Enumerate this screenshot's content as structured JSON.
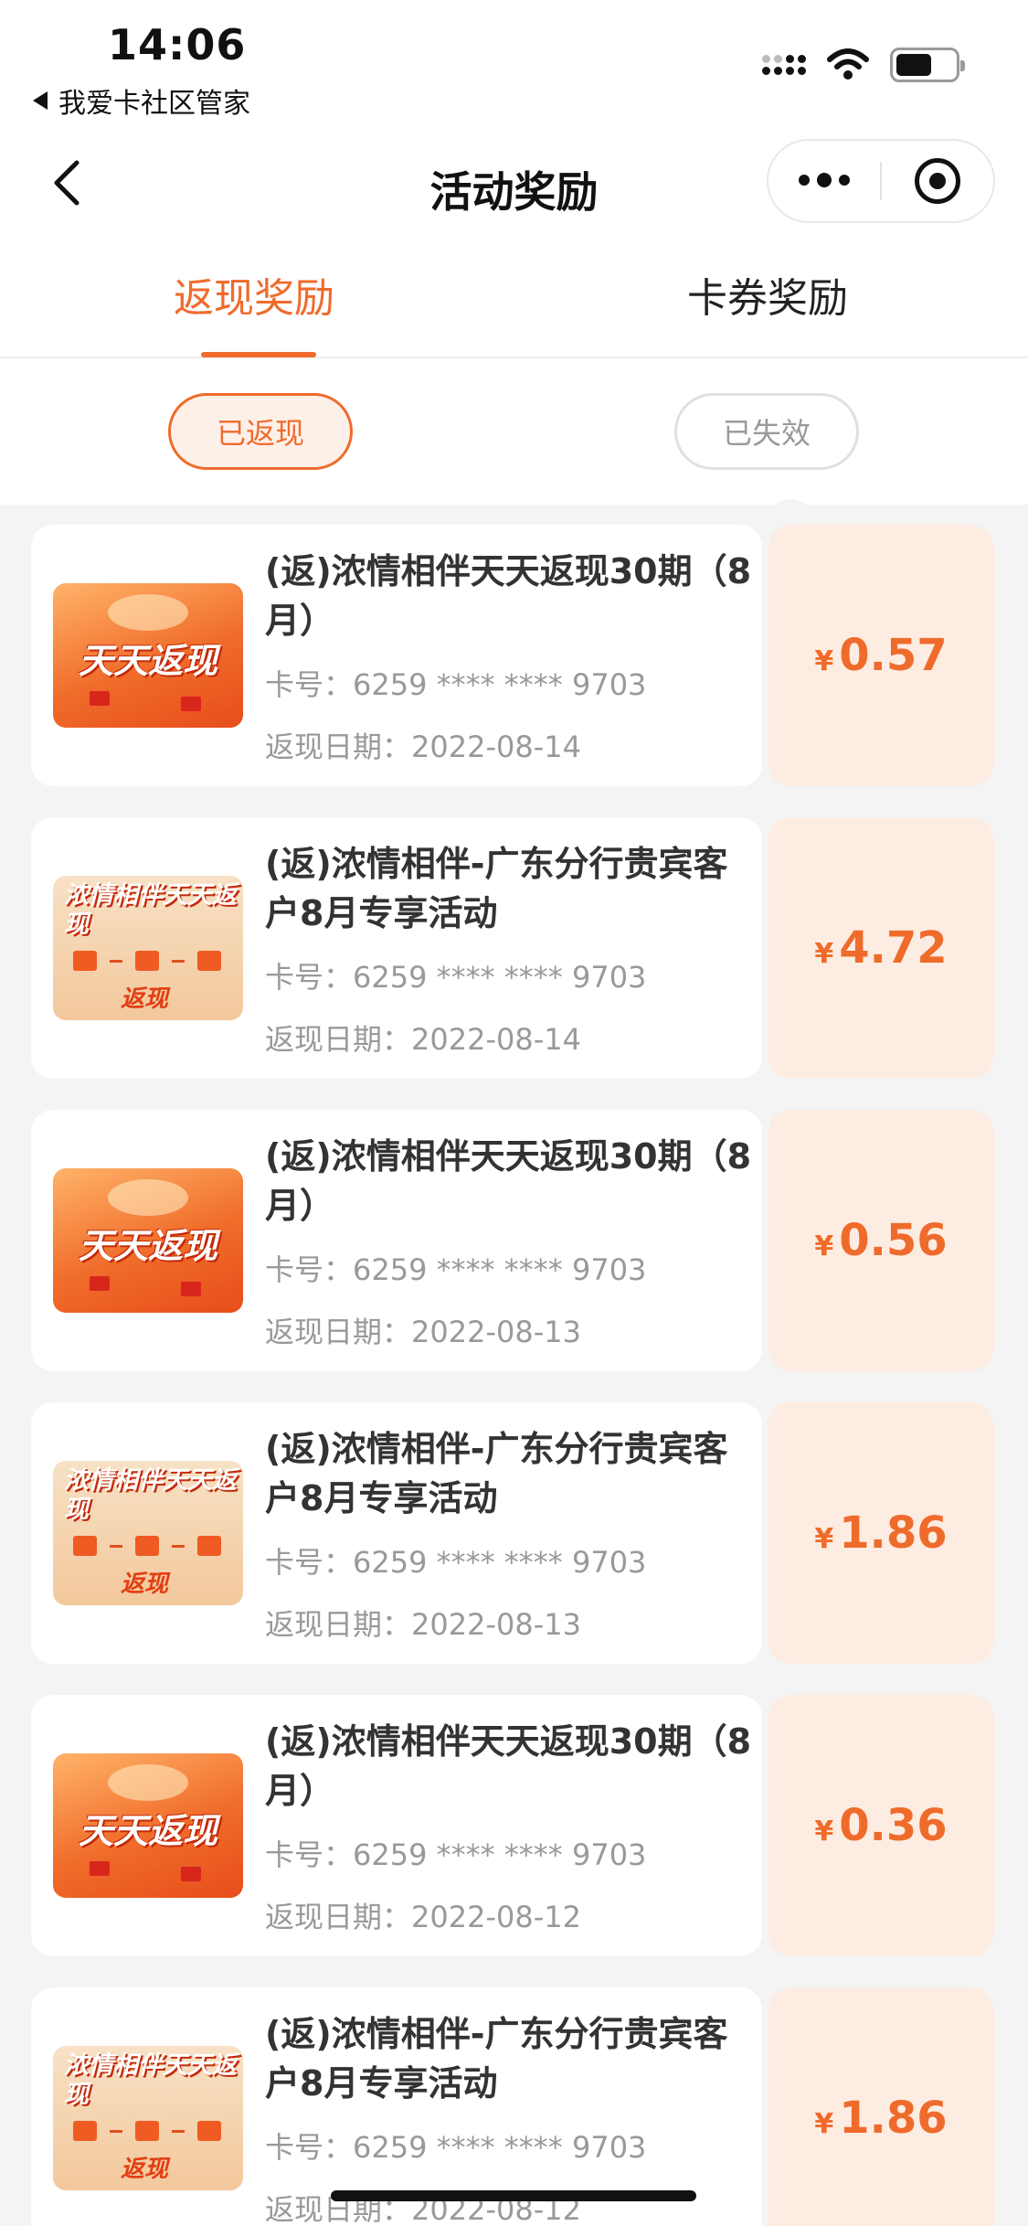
{
  "status_bar": {
    "time": "14:06",
    "back_app": "我爱卡社区管家"
  },
  "nav": {
    "title": "活动奖励"
  },
  "tabs": [
    {
      "label": "返现奖励",
      "active": true
    },
    {
      "label": "卡券奖励",
      "active": false
    }
  ],
  "filters": [
    {
      "label": "已返现",
      "active": true
    },
    {
      "label": "已失效",
      "active": false
    }
  ],
  "colors": {
    "accent": "#ef6b2c",
    "card_right_bg": "#fdece1"
  },
  "labels": {
    "card_prefix": "卡号：",
    "date_prefix": "返现日期：",
    "currency": "¥"
  },
  "rewards": [
    {
      "thumb": "天天返现",
      "title": "(返)浓情相伴天天返现30期（8月）",
      "card_no": "6259 **** **** 9703",
      "date": "2022-08-14",
      "amount": "0.57"
    },
    {
      "thumb": "浓情相伴天天返现",
      "thumb_tag": "返现",
      "title": "(返)浓情相伴-广东分行贵宾客户8月专享活动",
      "card_no": "6259 **** **** 9703",
      "date": "2022-08-14",
      "amount": "4.72"
    },
    {
      "thumb": "天天返现",
      "title": "(返)浓情相伴天天返现30期（8月）",
      "card_no": "6259 **** **** 9703",
      "date": "2022-08-13",
      "amount": "0.56"
    },
    {
      "thumb": "浓情相伴天天返现",
      "thumb_tag": "返现",
      "title": "(返)浓情相伴-广东分行贵宾客户8月专享活动",
      "card_no": "6259 **** **** 9703",
      "date": "2022-08-13",
      "amount": "1.86"
    },
    {
      "thumb": "天天返现",
      "title": "(返)浓情相伴天天返现30期（8月）",
      "card_no": "6259 **** **** 9703",
      "date": "2022-08-12",
      "amount": "0.36"
    },
    {
      "thumb": "浓情相伴天天返现",
      "thumb_tag": "返现",
      "title": "(返)浓情相伴-广东分行贵宾客户8月专享活动",
      "card_no": "6259 **** **** 9703",
      "date": "2022-08-12",
      "amount": "1.86"
    }
  ]
}
